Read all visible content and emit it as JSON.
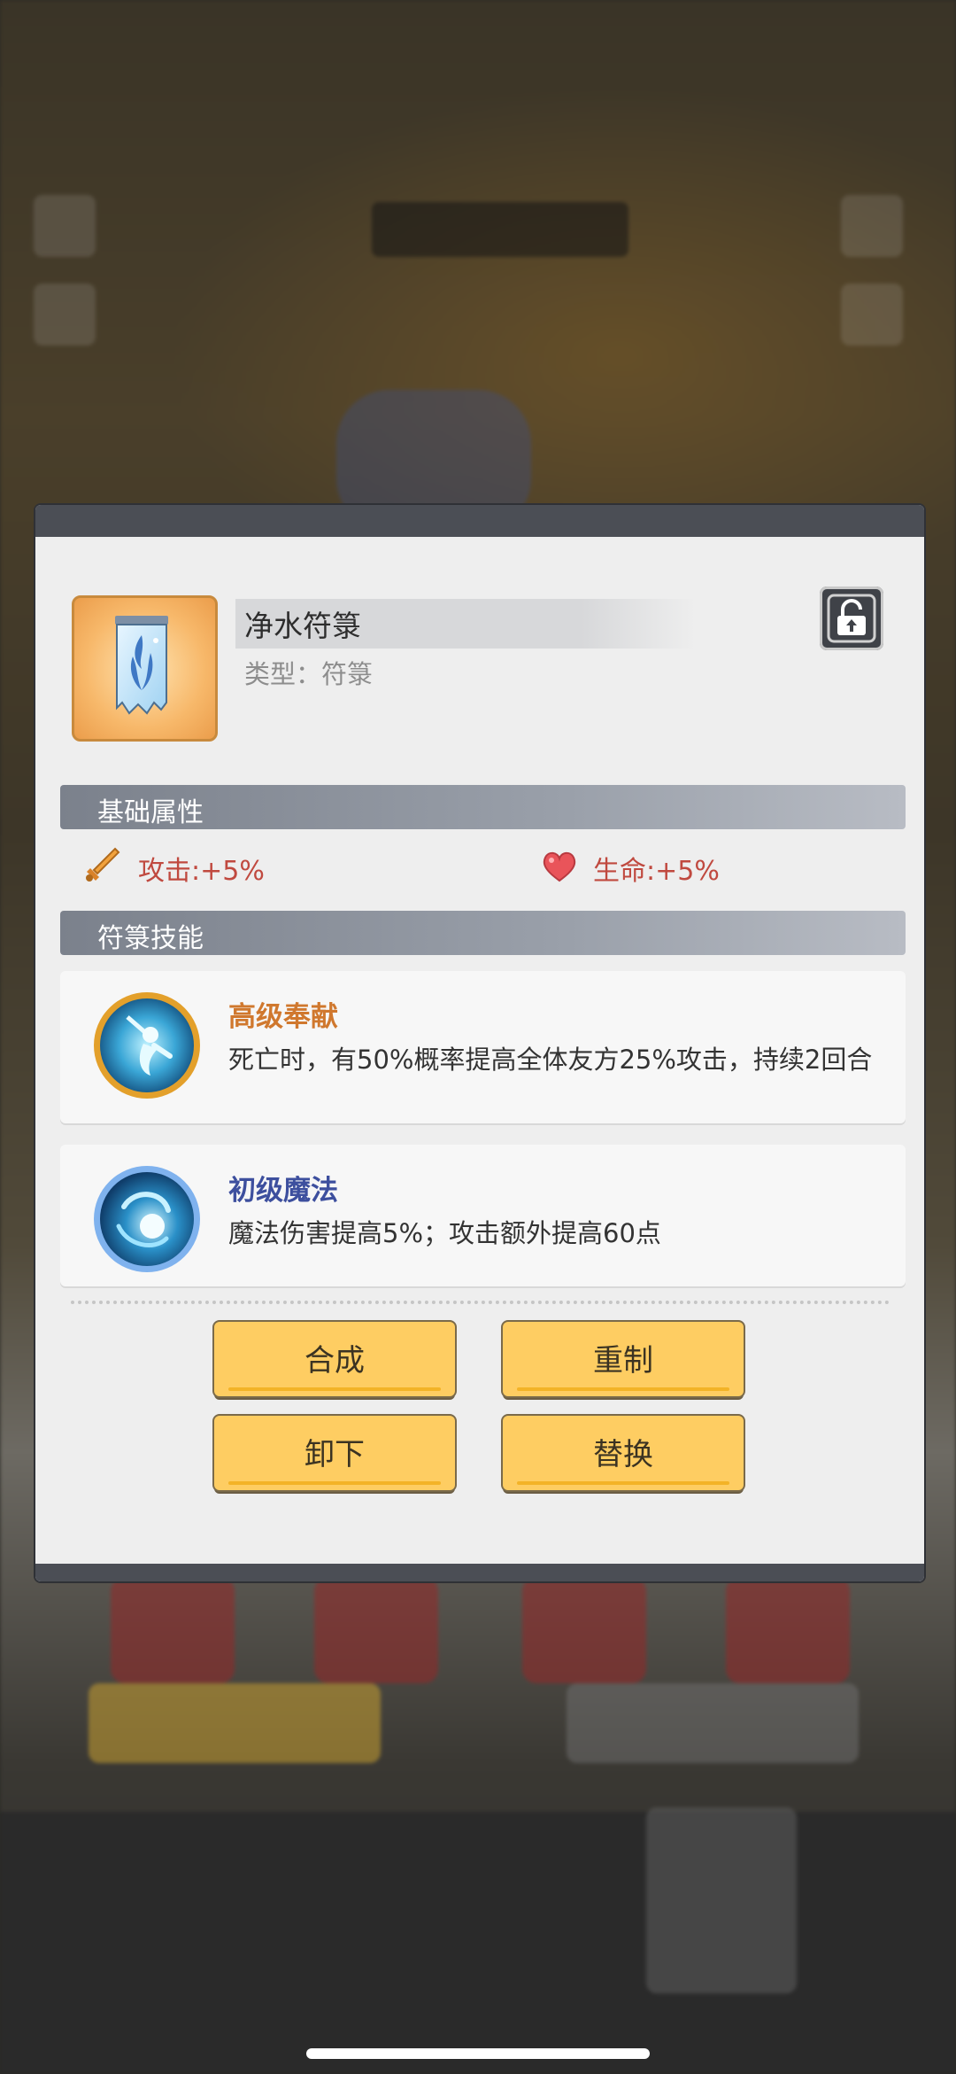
{
  "item": {
    "name": "净水符箓",
    "type": "类型：符箓",
    "lock_icon": "unlock-icon",
    "icon": "water-talisman-icon"
  },
  "sections": {
    "base_attributes": "基础属性",
    "talisman_skills": "符箓技能"
  },
  "stats": [
    {
      "icon": "sword-icon",
      "text": "攻击:+5%"
    },
    {
      "icon": "heart-icon",
      "text": "生命:+5%"
    }
  ],
  "skills": [
    {
      "name": "高级奉献",
      "desc": "死亡时，有50%概率提高全体友方25%攻击，持续2回合",
      "name_color": "#d0782e",
      "icon": "devotion-skill-icon"
    },
    {
      "name": "初级魔法",
      "desc": "魔法伤害提高5%；攻击额外提高60点",
      "name_color": "#3d4f9e",
      "icon": "magic-skill-icon"
    }
  ],
  "buttons": {
    "synthesize": "合成",
    "remake": "重制",
    "unequip": "卸下",
    "replace": "替换"
  },
  "colors": {
    "button_bg": "#fecd62",
    "stat_text": "#c0493f",
    "panel_bg": "#eeeeee"
  }
}
